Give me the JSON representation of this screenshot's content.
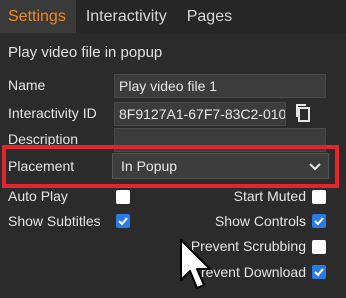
{
  "tabs": [
    {
      "label": "Settings",
      "active": true
    },
    {
      "label": "Interactivity",
      "active": false
    },
    {
      "label": "Pages",
      "active": false
    }
  ],
  "panel": {
    "title": "Play video file in popup",
    "fields": {
      "name_label": "Name",
      "name_value": "Play video file 1",
      "interactivity_id_label": "Interactivity ID",
      "interactivity_id_value": "8F9127A1-67F7-83C2-010",
      "description_label": "Description",
      "description_value": "",
      "placement_label": "Placement",
      "placement_value": "In Popup"
    },
    "options": {
      "auto_play": {
        "label": "Auto Play",
        "checked": false
      },
      "start_muted": {
        "label": "Start Muted",
        "checked": false
      },
      "show_subtitles": {
        "label": "Show Subtitles",
        "checked": true
      },
      "show_controls": {
        "label": "Show Controls",
        "checked": true
      },
      "prevent_scrubbing": {
        "label": "Prevent Scrubbing",
        "checked": false
      },
      "prevent_download": {
        "label": "revent Download",
        "checked": true
      }
    }
  },
  "colors": {
    "accent": "#f08a1c",
    "highlight": "#e3262b",
    "checkbox_checked": "#2a7be4"
  },
  "icons": {
    "copy": "copy-icon",
    "dropdown": "chevron-down-icon",
    "cursor": "mouse-pointer-icon"
  }
}
